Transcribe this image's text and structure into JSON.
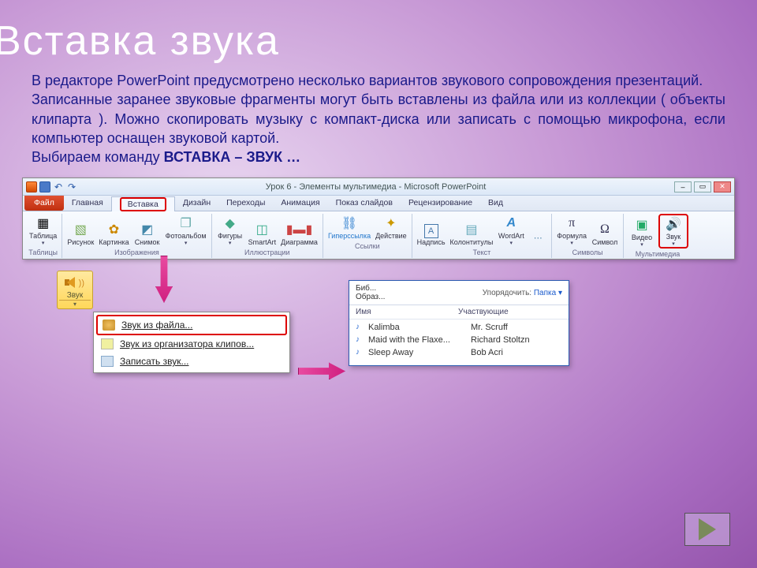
{
  "slide": {
    "title": "Вставка звука",
    "para1": "В редакторе PowerPoint предусмотрено несколько вариантов звукового сопровождения презентаций.",
    "para2": "Записанные заранее звуковые фрагменты могут быть вставлены из файла или из коллекции ( объекты клипарта ). Можно скопировать музыку с компакт-диска или записать с помощью микрофона, если компьютер оснащен звуковой картой.",
    "para3_prefix": "Выбираем команду ",
    "para3_bold": "ВСТАВКА – ЗВУК …"
  },
  "ribbon": {
    "window_title": "Урок 6 - Элементы мультимедиа - Microsoft PowerPoint",
    "tabs": {
      "file": "Файл",
      "home": "Главная",
      "insert": "Вставка",
      "design": "Дизайн",
      "transitions": "Переходы",
      "animations": "Анимация",
      "slideshow": "Показ слайдов",
      "review": "Рецензирование",
      "view": "Вид"
    },
    "groups": {
      "tables": "Таблицы",
      "images": "Изображения",
      "illustrations": "Иллюстрации",
      "links": "Ссылки",
      "text": "Текст",
      "symbols": "Символы",
      "media": "Мультимедиа"
    },
    "buttons": {
      "table": "Таблица",
      "picture": "Рисунок",
      "clipart": "Картинка",
      "screenshot": "Снимок",
      "photoalbum": "Фотоальбом",
      "shapes": "Фигуры",
      "smartart": "SmartArt",
      "chart": "Диаграмма",
      "hyperlink": "Гиперссылка",
      "action": "Действие",
      "textbox": "Надпись",
      "headerfooter": "Колонтитулы",
      "wordart": "WordArt",
      "equation": "Формула",
      "symbol": "Символ",
      "video": "Видео",
      "audio": "Звук"
    }
  },
  "sound_popup": {
    "label": "Звук"
  },
  "sound_menu": {
    "from_file": "Звук из файла...",
    "from_organizer": "Звук из организатора клипов...",
    "record": "Записать звук..."
  },
  "file_dialog": {
    "crumb1": "Биб...",
    "crumb2": "Образ...",
    "sort_label": "Упорядочить:",
    "sort_value": "Папка",
    "col_name": "Имя",
    "col_artists": "Участвующие",
    "rows": [
      {
        "name": "Kalimba",
        "artist": "Mr. Scruff"
      },
      {
        "name": "Maid with the Flaxe...",
        "artist": "Richard Stoltzn"
      },
      {
        "name": "Sleep Away",
        "artist": "Bob Acri"
      }
    ]
  }
}
